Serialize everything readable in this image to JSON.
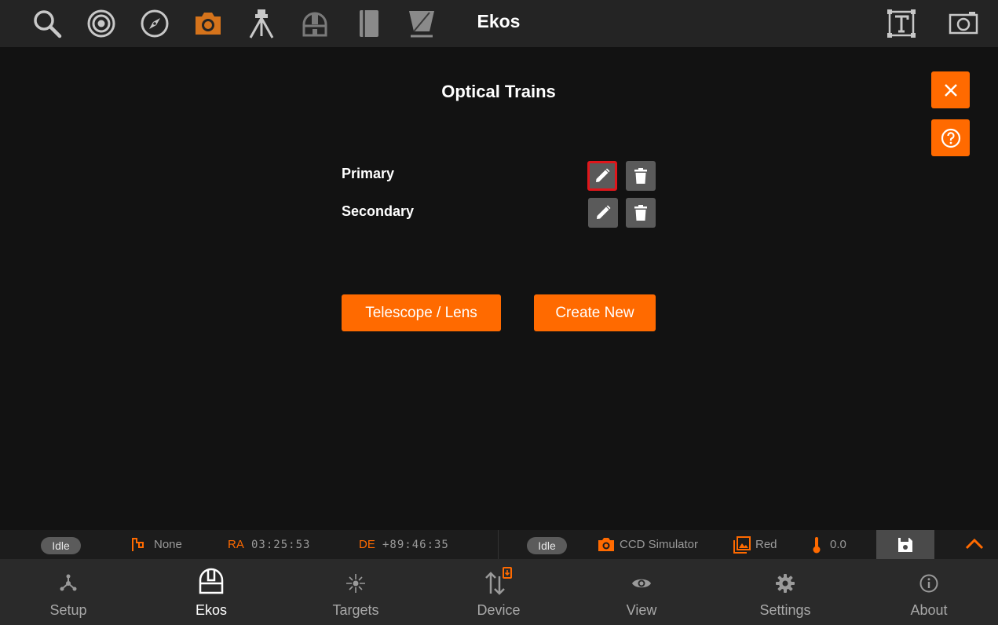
{
  "header": {
    "title": "Ekos",
    "icons": [
      "search-icon",
      "target-icon",
      "compass-icon",
      "camera-icon",
      "tripod-icon",
      "dome-icon",
      "notebook-icon",
      "flat-panel-icon",
      "text-frame-icon",
      "screenshot-icon"
    ],
    "accent": "#ff6a00"
  },
  "dialog": {
    "title": "Optical Trains",
    "trains": [
      {
        "label": "Primary"
      },
      {
        "label": "Secondary"
      }
    ],
    "telescope_button": "Telescope / Lens",
    "create_button": "Create New"
  },
  "status": {
    "mount_state": "Idle",
    "target_label": "None",
    "ra_label": "RA",
    "ra_value": "03:25:53",
    "de_label": "DE",
    "de_value": "+89:46:35",
    "camera_state": "Idle",
    "camera_name": "CCD Simulator",
    "filter": "Red",
    "temperature": "0.0"
  },
  "nav": {
    "items": [
      {
        "label": "Setup"
      },
      {
        "label": "Ekos"
      },
      {
        "label": "Targets"
      },
      {
        "label": "Device"
      },
      {
        "label": "View"
      },
      {
        "label": "Settings"
      },
      {
        "label": "About"
      }
    ],
    "active": "Ekos"
  }
}
